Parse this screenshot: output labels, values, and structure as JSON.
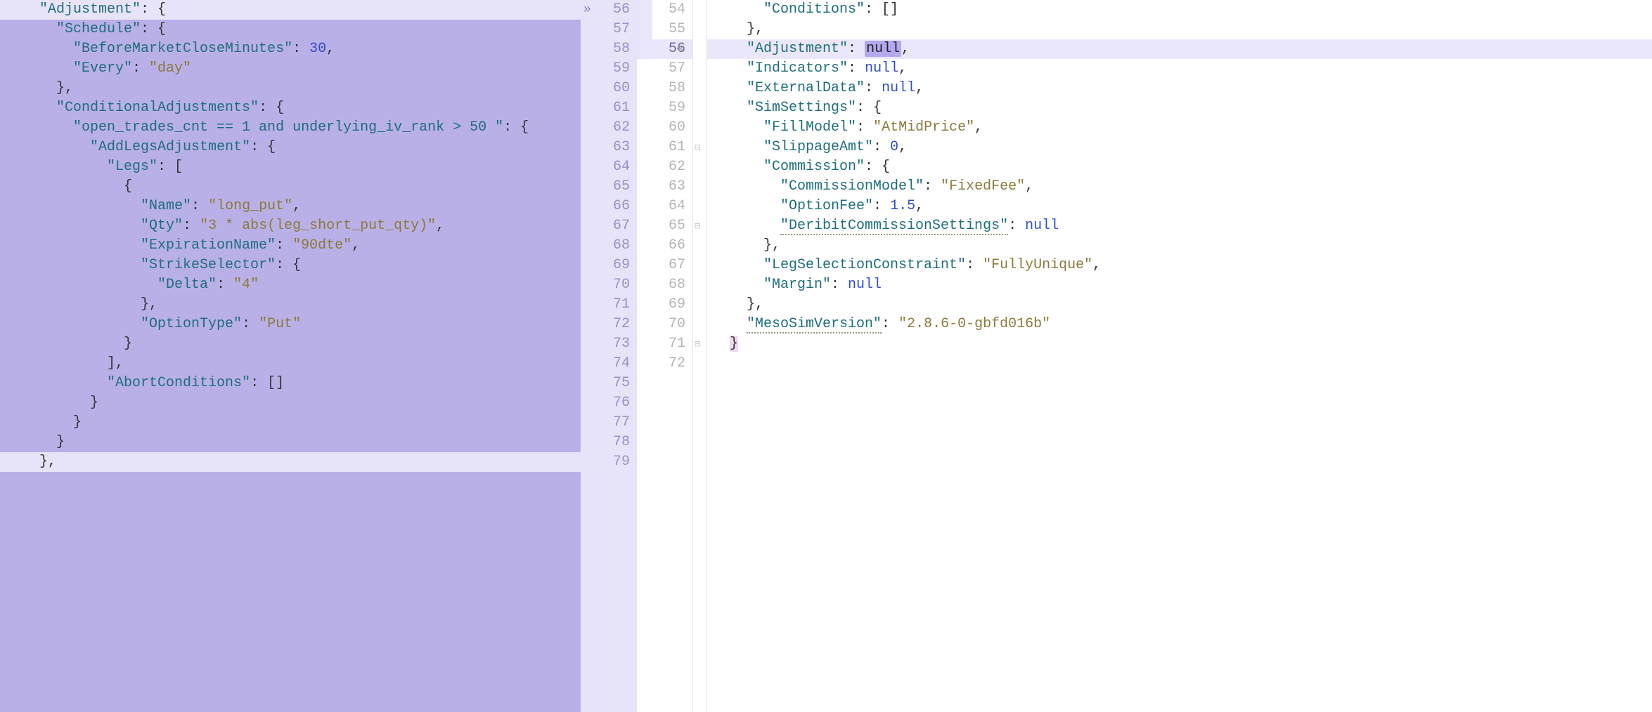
{
  "left": {
    "gutter_start": 56,
    "lines": [
      {
        "n": 56,
        "indent": 4,
        "tokens": [
          {
            "t": "\"Adjustment\"",
            "c": "key",
            "hl": true
          },
          {
            "t": ": {",
            "c": "punct"
          }
        ],
        "first": true
      },
      {
        "n": 57,
        "indent": 6,
        "tokens": [
          {
            "t": "\"Schedule\"",
            "c": "key"
          },
          {
            "t": ": {",
            "c": "punct"
          }
        ]
      },
      {
        "n": 58,
        "indent": 8,
        "tokens": [
          {
            "t": "\"BeforeMarketCloseMinutes\"",
            "c": "key"
          },
          {
            "t": ": ",
            "c": "punct"
          },
          {
            "t": "30",
            "c": "num"
          },
          {
            "t": ",",
            "c": "punct"
          }
        ]
      },
      {
        "n": 59,
        "indent": 8,
        "tokens": [
          {
            "t": "\"Every\"",
            "c": "key"
          },
          {
            "t": ": ",
            "c": "punct"
          },
          {
            "t": "\"day\"",
            "c": "string"
          }
        ]
      },
      {
        "n": 60,
        "indent": 6,
        "tokens": [
          {
            "t": "},",
            "c": "punct"
          }
        ]
      },
      {
        "n": 61,
        "indent": 6,
        "tokens": [
          {
            "t": "\"ConditionalAdjustments\"",
            "c": "key"
          },
          {
            "t": ": {",
            "c": "punct"
          }
        ]
      },
      {
        "n": 62,
        "indent": 8,
        "tokens": [
          {
            "t": "\"open_trades_cnt == 1 and underlying_iv_rank > 50 \"",
            "c": "key"
          },
          {
            "t": ": {",
            "c": "punct"
          }
        ]
      },
      {
        "n": 63,
        "indent": 10,
        "tokens": [
          {
            "t": "\"AddLegsAdjustment\"",
            "c": "key"
          },
          {
            "t": ": {",
            "c": "punct"
          }
        ]
      },
      {
        "n": 64,
        "indent": 12,
        "tokens": [
          {
            "t": "\"Legs\"",
            "c": "key"
          },
          {
            "t": ": [",
            "c": "punct"
          }
        ]
      },
      {
        "n": 65,
        "indent": 14,
        "tokens": [
          {
            "t": "{",
            "c": "punct"
          }
        ]
      },
      {
        "n": 66,
        "indent": 16,
        "tokens": [
          {
            "t": "\"Name\"",
            "c": "key"
          },
          {
            "t": ": ",
            "c": "punct"
          },
          {
            "t": "\"long_put\"",
            "c": "string"
          },
          {
            "t": ",",
            "c": "punct"
          }
        ]
      },
      {
        "n": 67,
        "indent": 16,
        "tokens": [
          {
            "t": "\"Qty\"",
            "c": "key"
          },
          {
            "t": ": ",
            "c": "punct"
          },
          {
            "t": "\"3 * abs(leg_short_put_qty)\"",
            "c": "string"
          },
          {
            "t": ",",
            "c": "punct"
          }
        ]
      },
      {
        "n": 68,
        "indent": 16,
        "tokens": [
          {
            "t": "\"ExpirationName\"",
            "c": "key"
          },
          {
            "t": ": ",
            "c": "punct"
          },
          {
            "t": "\"90dte\"",
            "c": "string"
          },
          {
            "t": ",",
            "c": "punct"
          }
        ]
      },
      {
        "n": 69,
        "indent": 16,
        "tokens": [
          {
            "t": "\"StrikeSelector\"",
            "c": "key"
          },
          {
            "t": ": {",
            "c": "punct"
          }
        ]
      },
      {
        "n": 70,
        "indent": 18,
        "tokens": [
          {
            "t": "\"Delta\"",
            "c": "key"
          },
          {
            "t": ": ",
            "c": "punct"
          },
          {
            "t": "\"4\"",
            "c": "string"
          }
        ]
      },
      {
        "n": 71,
        "indent": 16,
        "tokens": [
          {
            "t": "},",
            "c": "punct"
          }
        ]
      },
      {
        "n": 72,
        "indent": 16,
        "tokens": [
          {
            "t": "\"OptionType\"",
            "c": "key"
          },
          {
            "t": ": ",
            "c": "punct"
          },
          {
            "t": "\"Put\"",
            "c": "string"
          }
        ]
      },
      {
        "n": 73,
        "indent": 14,
        "tokens": [
          {
            "t": "}",
            "c": "punct"
          }
        ]
      },
      {
        "n": 74,
        "indent": 12,
        "tokens": [
          {
            "t": "],",
            "c": "punct"
          }
        ]
      },
      {
        "n": 75,
        "indent": 12,
        "tokens": [
          {
            "t": "\"AbortConditions\"",
            "c": "key"
          },
          {
            "t": ": []",
            "c": "punct"
          }
        ]
      },
      {
        "n": 76,
        "indent": 10,
        "tokens": [
          {
            "t": "}",
            "c": "punct"
          }
        ]
      },
      {
        "n": 77,
        "indent": 8,
        "tokens": [
          {
            "t": "}",
            "c": "punct"
          }
        ]
      },
      {
        "n": 78,
        "indent": 6,
        "tokens": [
          {
            "t": "}",
            "c": "punct"
          }
        ]
      },
      {
        "n": 79,
        "indent": 4,
        "tokens": [
          {
            "t": "},",
            "c": "punct"
          }
        ],
        "last": true
      }
    ]
  },
  "right": {
    "lines": [
      {
        "n": 54,
        "indent": 6,
        "tokens": [
          {
            "t": "\"Conditions\"",
            "c": "key"
          },
          {
            "t": ": []",
            "c": "punct"
          }
        ]
      },
      {
        "n": 55,
        "indent": 4,
        "tokens": [
          {
            "t": "},",
            "c": "punct"
          }
        ]
      },
      {
        "n": 56,
        "indent": 4,
        "hl": true,
        "tokens": [
          {
            "t": "\"Adjustment\"",
            "c": "key"
          },
          {
            "t": ": ",
            "c": "punct"
          },
          {
            "t": "null",
            "c": "null",
            "hlbox": true
          },
          {
            "t": ",",
            "c": "punct"
          }
        ]
      },
      {
        "n": 57,
        "indent": 4,
        "tokens": [
          {
            "t": "\"Indicators\"",
            "c": "key"
          },
          {
            "t": ": ",
            "c": "punct"
          },
          {
            "t": "null",
            "c": "null"
          },
          {
            "t": ",",
            "c": "punct"
          }
        ]
      },
      {
        "n": 58,
        "indent": 4,
        "tokens": [
          {
            "t": "\"ExternalData\"",
            "c": "key"
          },
          {
            "t": ": ",
            "c": "punct"
          },
          {
            "t": "null",
            "c": "null"
          },
          {
            "t": ",",
            "c": "punct"
          }
        ]
      },
      {
        "n": 59,
        "indent": 4,
        "tokens": [
          {
            "t": "\"SimSettings\"",
            "c": "key"
          },
          {
            "t": ": {",
            "c": "punct"
          }
        ]
      },
      {
        "n": 60,
        "indent": 6,
        "tokens": [
          {
            "t": "\"FillModel\"",
            "c": "key"
          },
          {
            "t": ": ",
            "c": "punct"
          },
          {
            "t": "\"AtMidPrice\"",
            "c": "string"
          },
          {
            "t": ",",
            "c": "punct"
          }
        ]
      },
      {
        "n": 61,
        "indent": 6,
        "fold": true,
        "tokens": [
          {
            "t": "\"SlippageAmt\"",
            "c": "key"
          },
          {
            "t": ": ",
            "c": "punct"
          },
          {
            "t": "0",
            "c": "num"
          },
          {
            "t": ",",
            "c": "punct"
          }
        ]
      },
      {
        "n": 62,
        "indent": 6,
        "tokens": [
          {
            "t": "\"Commission\"",
            "c": "key"
          },
          {
            "t": ": {",
            "c": "punct"
          }
        ]
      },
      {
        "n": 63,
        "indent": 8,
        "tokens": [
          {
            "t": "\"CommissionModel\"",
            "c": "key"
          },
          {
            "t": ": ",
            "c": "punct"
          },
          {
            "t": "\"FixedFee\"",
            "c": "string"
          },
          {
            "t": ",",
            "c": "punct"
          }
        ]
      },
      {
        "n": 64,
        "indent": 8,
        "tokens": [
          {
            "t": "\"OptionFee\"",
            "c": "key"
          },
          {
            "t": ": ",
            "c": "punct"
          },
          {
            "t": "1.5",
            "c": "num"
          },
          {
            "t": ",",
            "c": "punct"
          }
        ]
      },
      {
        "n": 65,
        "indent": 8,
        "fold": true,
        "tokens": [
          {
            "t": "\"DeribitCommissionSettings\"",
            "c": "key",
            "sq": true
          },
          {
            "t": ": ",
            "c": "punct"
          },
          {
            "t": "null",
            "c": "null"
          }
        ]
      },
      {
        "n": 66,
        "indent": 6,
        "tokens": [
          {
            "t": "},",
            "c": "punct"
          }
        ]
      },
      {
        "n": 67,
        "indent": 6,
        "tokens": [
          {
            "t": "\"LegSelectionConstraint\"",
            "c": "key"
          },
          {
            "t": ": ",
            "c": "punct"
          },
          {
            "t": "\"FullyUnique\"",
            "c": "string"
          },
          {
            "t": ",",
            "c": "punct"
          }
        ]
      },
      {
        "n": 68,
        "indent": 6,
        "tokens": [
          {
            "t": "\"Margin\"",
            "c": "key"
          },
          {
            "t": ": ",
            "c": "punct"
          },
          {
            "t": "null",
            "c": "null"
          }
        ]
      },
      {
        "n": 69,
        "indent": 4,
        "tokens": [
          {
            "t": "},",
            "c": "punct"
          }
        ]
      },
      {
        "n": 70,
        "indent": 4,
        "tokens": [
          {
            "t": "\"MesoSimVersion\"",
            "c": "key",
            "sq": true
          },
          {
            "t": ": ",
            "c": "punct"
          },
          {
            "t": "\"2.8.6-0-gbfd016b\"",
            "c": "string"
          }
        ]
      },
      {
        "n": 71,
        "indent": 2,
        "fold": true,
        "tokens": [
          {
            "t": "}",
            "c": "punct",
            "bracehl": true
          }
        ]
      },
      {
        "n": 72,
        "indent": 0,
        "tokens": []
      }
    ]
  },
  "chev": {
    "left": "»",
    "right": "«"
  }
}
